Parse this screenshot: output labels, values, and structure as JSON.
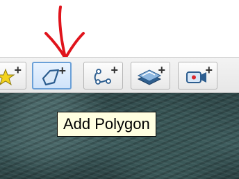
{
  "annotation": {
    "color": "#e0141c"
  },
  "toolbar": {
    "tools": [
      {
        "icon": "add-placemark-pin-icon",
        "tooltip": ""
      },
      {
        "icon": "add-polygon-icon",
        "tooltip": "Add Polygon",
        "active": true
      },
      {
        "icon": "add-path-icon",
        "tooltip": ""
      },
      {
        "icon": "add-image-overlay-icon",
        "tooltip": ""
      },
      {
        "icon": "record-tour-icon",
        "tooltip": ""
      }
    ],
    "plus_glyph": "+"
  },
  "tooltip": {
    "text": "Add Polygon"
  },
  "colors": {
    "active_border": "#6aa0d8",
    "tooltip_bg": "#ffffe1",
    "imagery": "#3f5e5f"
  }
}
